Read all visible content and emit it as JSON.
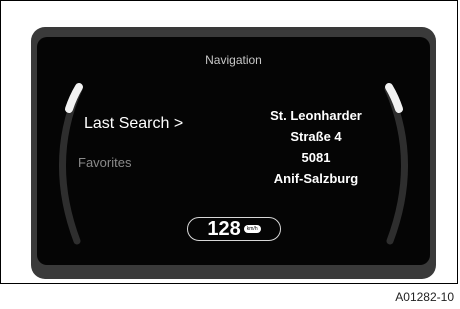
{
  "screen": {
    "title": "Navigation",
    "menu": {
      "last_search_label": "Last Search >",
      "favorites_label": "Favorites"
    },
    "address": {
      "line1": "St. Leonharder",
      "line2": "Straße 4",
      "line3": "5081",
      "line4": "Anif-Salzburg"
    },
    "speed": {
      "value": "128",
      "unit": "km/h"
    }
  },
  "figure": {
    "caption": "A01282-10"
  }
}
